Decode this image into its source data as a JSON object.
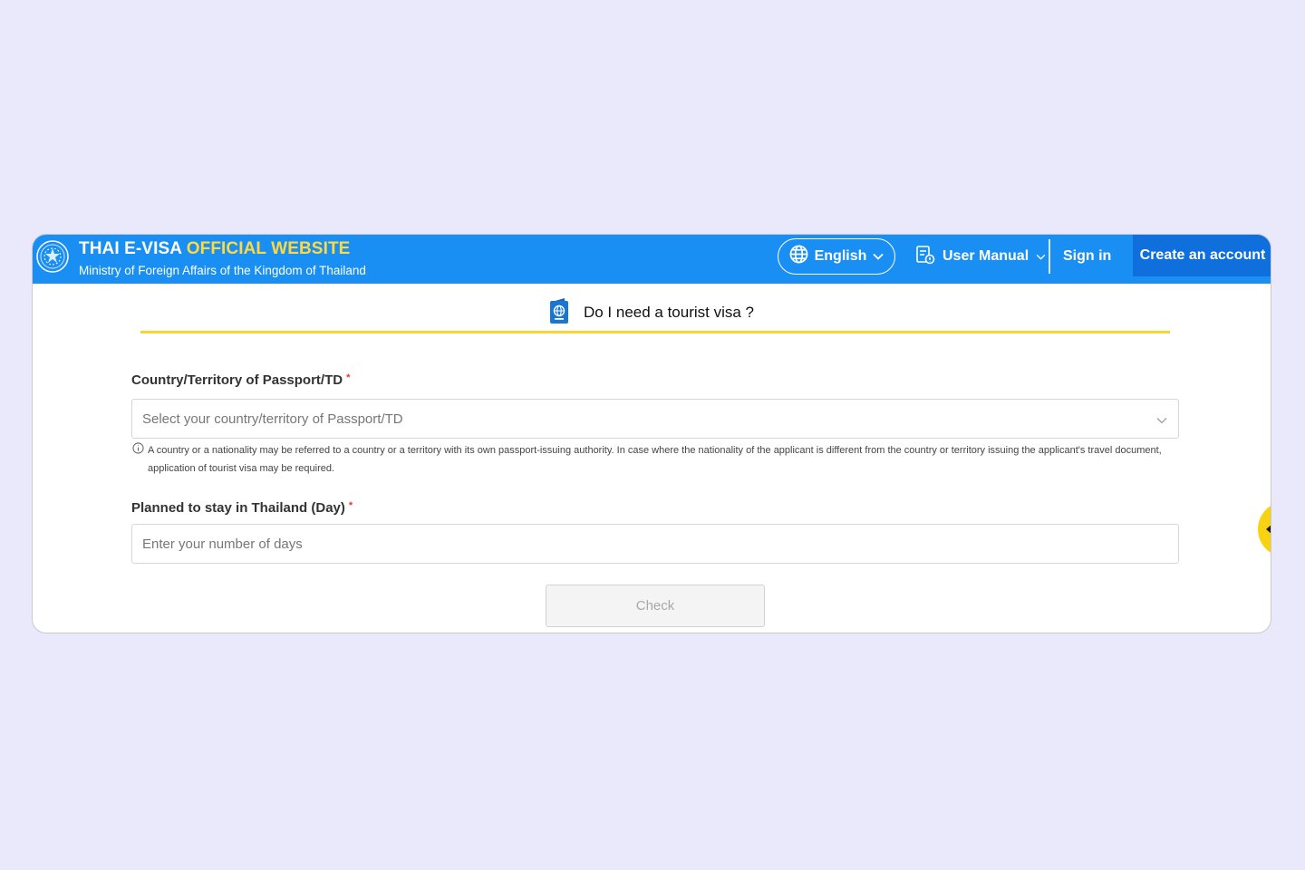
{
  "header": {
    "title_part1": "THAI E-VISA ",
    "title_part2": "OFFICIAL WEBSITE",
    "subtitle": "Ministry of Foreign Affairs of the Kingdom of Thailand",
    "language_label": "English",
    "user_manual_label": "User Manual",
    "sign_in_label": "Sign in",
    "create_account_label": "Create an account"
  },
  "heading": {
    "title": "Do I need a tourist visa ?"
  },
  "form": {
    "country_label": "Country/Territory of Passport/TD",
    "required_mark": "*",
    "country_placeholder": "Select your country/territory of Passport/TD",
    "country_hint": "A country or a nationality may be referred to a country or a territory with its own passport-issuing authority. In case where the nationality of the applicant is different from the country or territory issuing the applicant's travel document, application of tourist visa may be required.",
    "stay_label": "Planned to stay in Thailand (Day)",
    "stay_placeholder": "Enter your number of days",
    "check_label": "Check"
  },
  "colors": {
    "header_blue": "#1a8ff3",
    "accent_yellow": "#ffd93d",
    "create_button_blue": "#0f6fdc",
    "required_red": "#e53935"
  },
  "icons": [
    "seal-logo",
    "globe-icon",
    "chevron-down-icon",
    "manual-icon",
    "passport-icon",
    "info-icon",
    "arrow-left-icon"
  ]
}
